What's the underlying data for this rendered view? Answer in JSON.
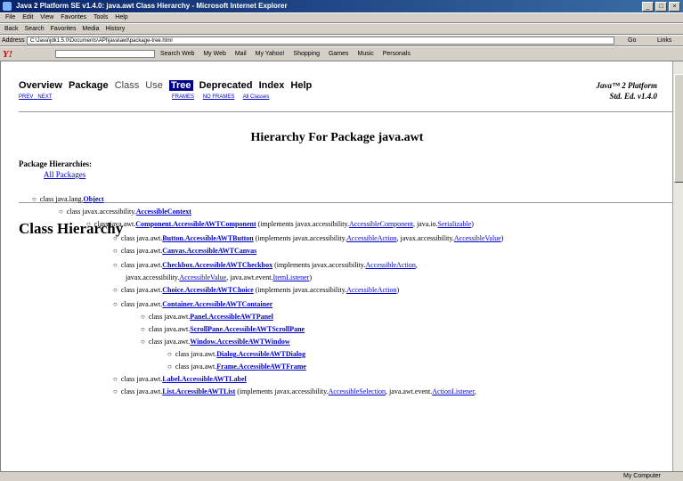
{
  "window": {
    "title": "Java 2 Platform SE v1.4.0: java.awt Class Hierarchy - Microsoft Internet Explorer",
    "min": "_",
    "max": "□",
    "close": "×"
  },
  "menu": [
    "File",
    "Edit",
    "View",
    "Favorites",
    "Tools",
    "Help"
  ],
  "toolbar": [
    "Back",
    "Search",
    "Favorites",
    "Media",
    "History"
  ],
  "address": {
    "label": "Address",
    "value": "C:\\Java\\jdk1.5.0\\Documents\\API\\java\\awt\\package-tree.html",
    "go": "Go",
    "links": "Links"
  },
  "yahoo": {
    "logo": "Y!",
    "search_label": "Search Web",
    "items": [
      "My Web",
      "Mail",
      "My Yahoo!",
      "Shopping",
      "Games",
      "Music",
      "Personals"
    ]
  },
  "nav": {
    "items": [
      "Overview",
      "Package",
      "Class",
      "Use",
      "Tree",
      "Deprecated",
      "Index",
      "Help"
    ],
    "prev": "PREV",
    "next": "NEXT",
    "frames": "FRAMES",
    "noframes": "NO FRAMES",
    "allclasses": "All Classes",
    "platform_line1": "Java™ 2 Platform",
    "platform_line2": "Std. Ed. v1.4.0"
  },
  "content": {
    "heading": "Hierarchy For Package java.awt",
    "pkg_hier_label": "Package Hierarchies:",
    "all_packages": "All Packages",
    "class_hierarchy": "Class Hierarchy"
  },
  "tree": [
    {
      "prefix": "class java.lang.",
      "link": "Object",
      "suffix": ""
    },
    {
      "prefix": "class javax.accessibility.",
      "link": "AccessibleContext",
      "suffix": ""
    },
    {
      "prefix": "class java.awt.",
      "link": "Component.AccessibleAWTComponent",
      "suffix": " (implements javax.accessibility.",
      "link2": "AccessibleComponent",
      "suffix2": ", java.io.",
      "link3": "Serializable",
      "suffix3": ")"
    },
    {
      "prefix": "class java.awt.",
      "link": "Button.AccessibleAWTButton",
      "suffix": " (implements javax.accessibility.",
      "link2": "AccessibleAction",
      "suffix2": ", javax.accessibility.",
      "link3": "AccessibleValue",
      "suffix3": ")"
    },
    {
      "prefix": "class java.awt.",
      "link": "Canvas.AccessibleAWTCanvas",
      "suffix": ""
    },
    {
      "prefix": "class java.awt.",
      "link": "Checkbox.AccessibleAWTCheckbox",
      "suffix": " (implements javax.accessibility.",
      "link2": "AccessibleAction",
      "suffix2": ","
    },
    {
      "prefix": "javax.accessibility.",
      "link2": "AccessibleValue",
      "suffix2": ", java.awt.event.",
      "link3": "ItemListener",
      "suffix3": ")"
    },
    {
      "prefix": "class java.awt.",
      "link": "Choice.AccessibleAWTChoice",
      "suffix": " (implements javax.accessibility.",
      "link2": "AccessibleAction",
      "suffix2": ")"
    },
    {
      "prefix": "class java.awt.",
      "link": "Container.AccessibleAWTContainer",
      "suffix": ""
    },
    {
      "prefix": "class java.awt.",
      "link": "Panel.AccessibleAWTPanel",
      "suffix": ""
    },
    {
      "prefix": "class java.awt.",
      "link": "ScrollPane.AccessibleAWTScrollPane",
      "suffix": ""
    },
    {
      "prefix": "class java.awt.",
      "link": "Window.AccessibleAWTWindow",
      "suffix": ""
    },
    {
      "prefix": "class java.awt.",
      "link": "Dialog.AccessibleAWTDialog",
      "suffix": ""
    },
    {
      "prefix": "class java.awt.",
      "link": "Frame.AccessibleAWTFrame",
      "suffix": ""
    },
    {
      "prefix": "class java.awt.",
      "link": "Label.AccessibleAWTLabel",
      "suffix": ""
    },
    {
      "prefix": "class java.awt.",
      "link": "List.AccessibleAWTList",
      "suffix": " (implements javax.accessibility.",
      "link2": "AccessibleSelection",
      "suffix2": ", java.awt.event.",
      "link3": "ActionListener",
      "suffix3": ","
    }
  ],
  "status": {
    "zone": "My Computer"
  }
}
